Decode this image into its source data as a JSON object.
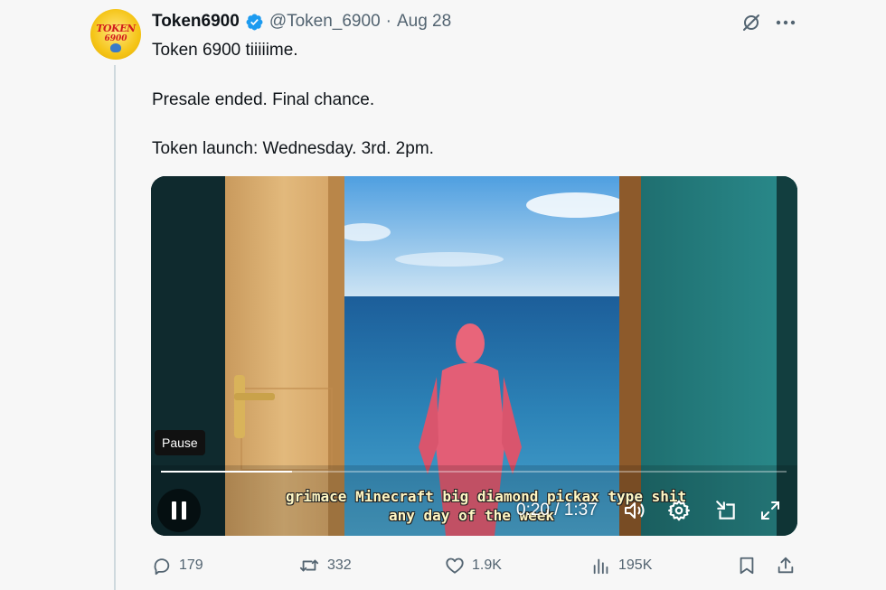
{
  "author": {
    "name": "Token6900",
    "handle": "@Token_6900",
    "separator": "·",
    "date": "Aug 28",
    "avatar_text_top": "TOKEN",
    "avatar_text_bottom": "6900",
    "verified": true
  },
  "tweet": {
    "lines": [
      "Token 6900 tiiiiime.",
      "Presale ended. Final chance.",
      "Token launch: Wednesday. 3rd. 2pm."
    ]
  },
  "video": {
    "tooltip": "Pause",
    "progress": 0.21,
    "current_time": "0:20",
    "duration": "1:37",
    "time_separator": " / ",
    "caption_line1": "grimace Minecraft big diamond pickax type shit",
    "caption_line2": "any day of the week",
    "controls": [
      "pause-icon",
      "volume-icon",
      "settings-gear-icon",
      "dock-icon",
      "expand-icon"
    ]
  },
  "metrics": {
    "replies": "179",
    "reposts": "332",
    "likes": "1.9K",
    "views": "195K"
  },
  "colors": {
    "verified": "#1d9bf0",
    "text_primary": "#0f1419",
    "text_secondary": "#536471",
    "background": "#f7f7f7"
  }
}
